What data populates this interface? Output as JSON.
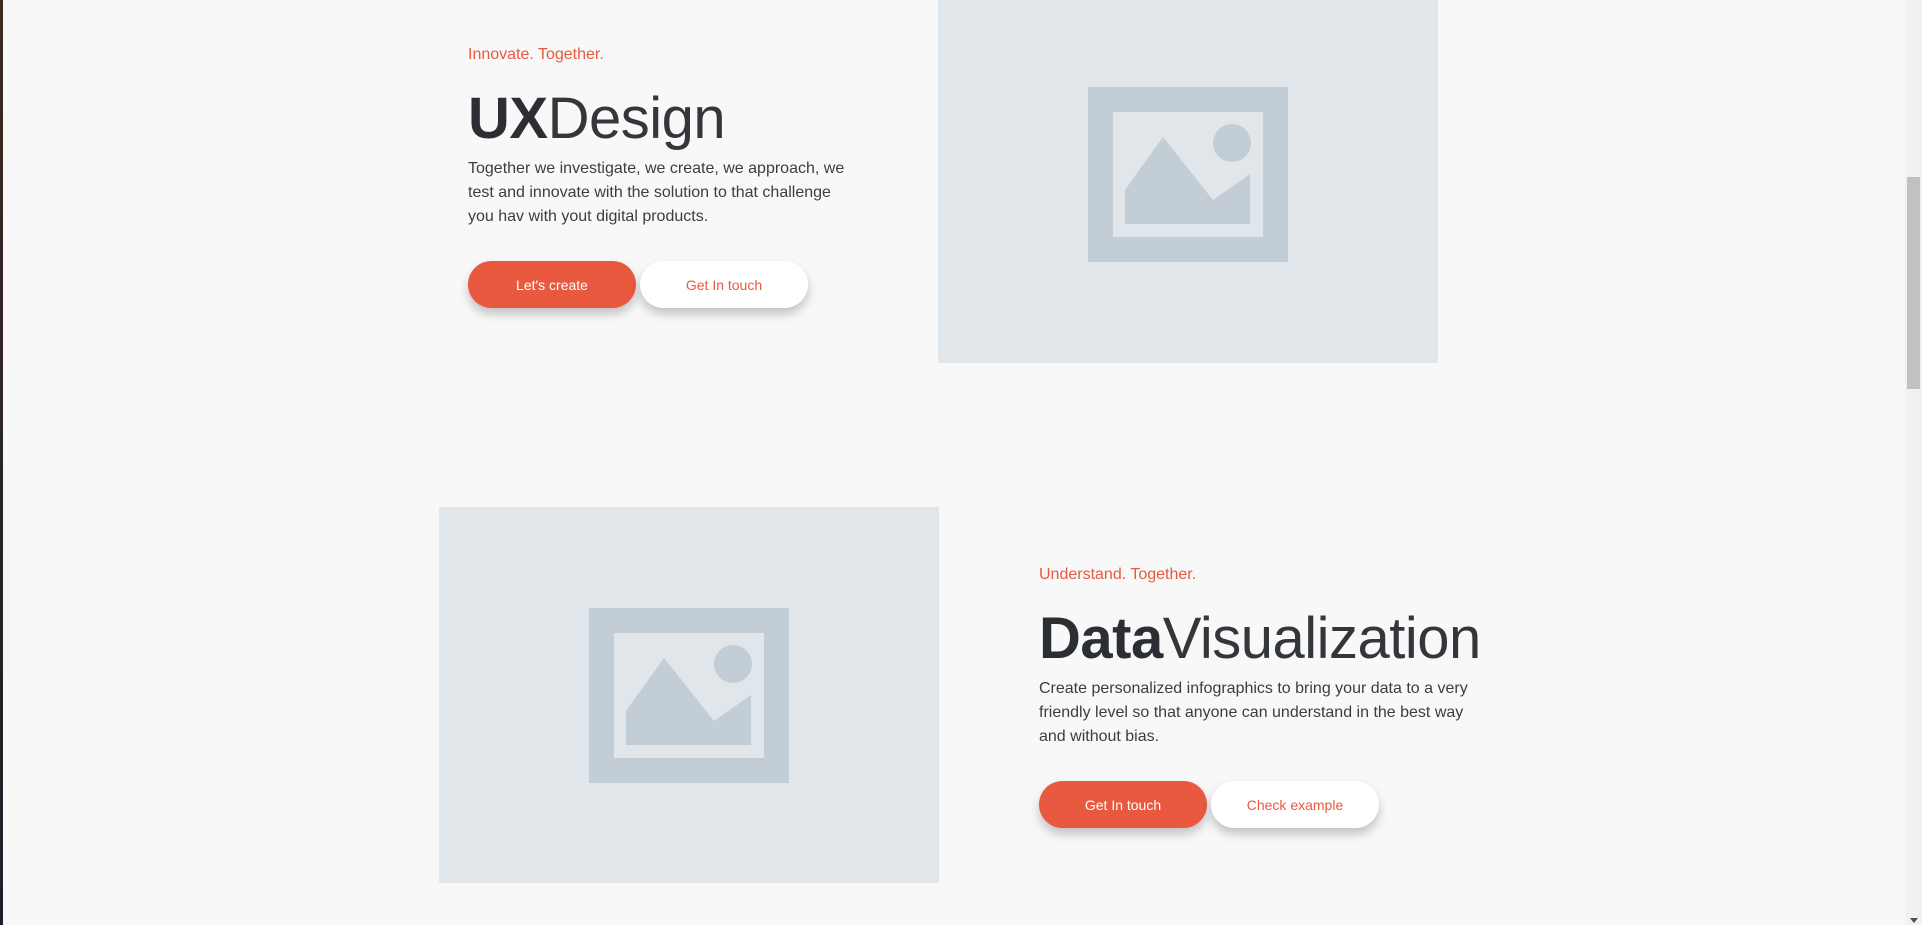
{
  "sections": [
    {
      "eyebrow": "Innovate. Together.",
      "title_strong": "UX",
      "title_light": "Design",
      "description": "Together we investigate, we create, we approach, we test and innovate with the solution to that challenge you hav with yout digital products.",
      "primary_button": "Let's create",
      "secondary_button": "Get In touch"
    },
    {
      "eyebrow": "Understand. Together.",
      "title_strong": "Data",
      "title_light": "Visualization",
      "description": "Create personalized infographics to bring your data to a very friendly level so that anyone can understand in the best way and without bias.",
      "primary_button": "Get In touch",
      "secondary_button": "Check example"
    }
  ],
  "colors": {
    "accent": "#e8593f",
    "background": "#f8f8f8",
    "placeholder": "#e1e6ea",
    "placeholder_icon": "#c3cdd5"
  },
  "icons": {
    "image_placeholder": "image-placeholder-icon"
  }
}
